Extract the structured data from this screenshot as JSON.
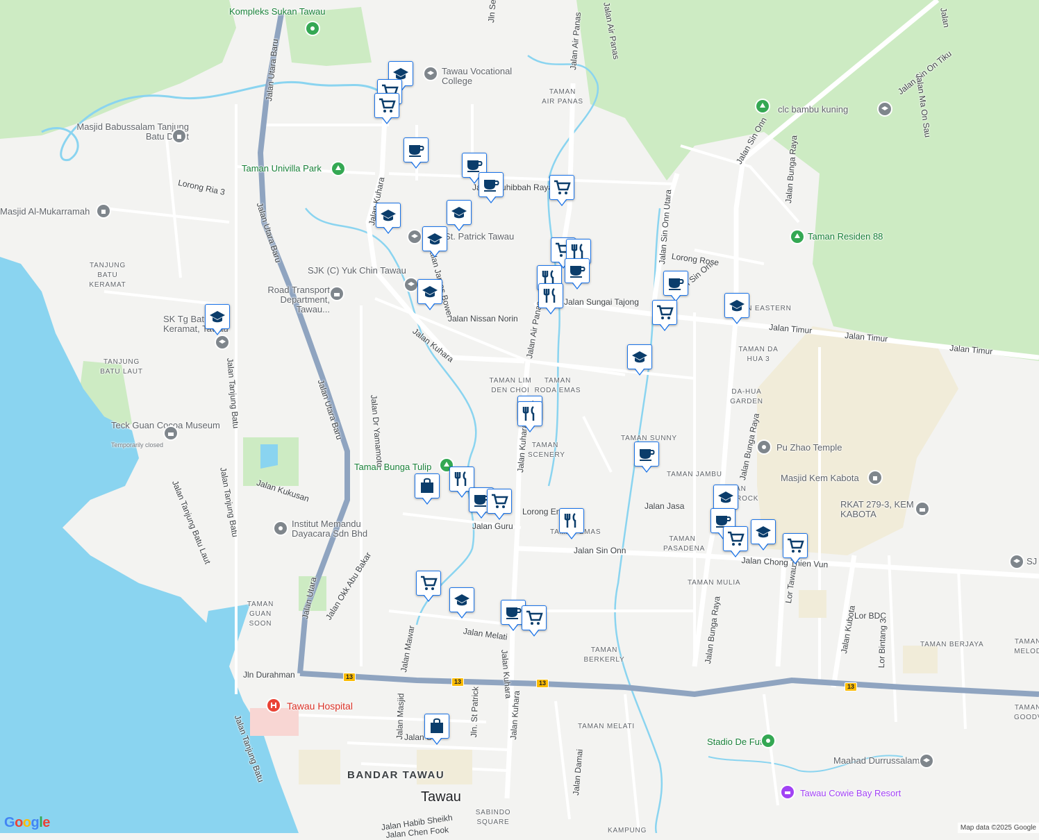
{
  "map": {
    "attribution": "Map data ©2025 Google",
    "logo": "Google",
    "colors": {
      "water": "#8ad4f0",
      "green": "#cdebc3",
      "road": "#ffffff",
      "highway": "#8fa4c0",
      "landuse": "#f3f3f1",
      "sand": "#f1ecd9"
    }
  },
  "labels": {
    "kompleks_sukan": "Kompleks Sukan Tawau",
    "tawau_vocational": "Tawau Vocational College",
    "masjid_babussalam": "Masjid Babussalam Tanjung Batu Darat",
    "taman_univilla": "Taman Univilla Park",
    "masjid_mukarramah": "Masjid Al-Mukarramah",
    "tanjung_batu_keramat": "TANJUNG BATU KERAMAT",
    "sjk_yuk_chin": "SJK (C) Yuk Chin Tawau",
    "road_transport": "Road Transport Department, Tawau...",
    "sk_tg_batu": "SK Tg Batu Keramat, Tawau",
    "tanjung_batu_laut": "TANJUNG BATU LAUT",
    "teck_guan": "Teck Guan Cocoa Museum",
    "teck_guan_status": "Temporarily closed",
    "taman_bunga_tulip": "Taman Bunga Tulip",
    "institut_memandu": "Institut Memandu Dayacara Sdn Bhd",
    "taman_guan_soon": "TAMAN GUAN SOON",
    "tawau_hospital": "Tawau Hospital",
    "bandar_tawau": "BANDAR TAWAU",
    "tawau": "Tawau",
    "sabindo_square": "SABINDO SQUARE",
    "taman_air_panas": "TAMAN AIR PANAS",
    "st_patrick": "St. Patrick Tawau",
    "clc_bambu": "clc bambu kuning",
    "taman_residen": "Taman Residen 88",
    "taman_eastern": "TAMAN EASTERN",
    "taman_da_hua": "TAMAN DA HUA 3",
    "da_hua_garden": "DA-HUA GARDEN",
    "taman_lim": "TAMAN LIM DEN CHOI",
    "taman_roda": "TAMAN RODA EMAS",
    "taman_scenery": "TAMAN SCENERY",
    "taman_sunny": "TAMAN SUNNY",
    "taman_jambu": "TAMAN JAMBU",
    "pu_zhao": "Pu Zhao Temple",
    "masjid_kem": "Masjid Kem Kabota",
    "rkat": "RKAT 279-3, KEM KABOTA",
    "taman_shamrock": "TAMAN SHAMROCK",
    "taman_pasadena": "TAMAN PASADENA",
    "taman_mulia": "TAMAN MULIA",
    "taman_emas": "TAMAN EMAS",
    "taman_berkerly": "TAMAN BERKERLY",
    "taman_melati": "TAMAN MELATI",
    "taman_berjaya": "TAMAN BERJAYA",
    "taman_melod": "TAMAN MELOD",
    "taman_goodv": "TAMAN GOODV",
    "stadio": "Stadio De Futsal",
    "maahad": "Maahad Durrussalam",
    "cowie_bay": "Tawau Cowie Bay Resort",
    "kampung": "KAMPUNG",
    "sj_edge": "SJ"
  },
  "roads": {
    "jalan_utara_baru_1": "Jalan Utara Baru",
    "jalan_utara_baru_2": "Jalan Utara Baru",
    "jalan_utara_baru_3": "Jalan Utara Baru",
    "jalan_utara": "Jalan Utara",
    "lorong_ria": "Lorong Ria 3",
    "jalan_kuhara_n": "Jalan Kuhara",
    "jalan_kuhara_m": "Jalan Kuhara",
    "jalan_kuhara_s": "Jalan Kuhara",
    "jalan_kuhara_c": "Jalan Kuhara",
    "jalan_kuhara_x": "Jalan Kuhara",
    "jalan_muhibbah": "Jalan Muhibbah Raya",
    "jalan_james": "Jalan James Bower",
    "jalan_nissan": "Jalan Nissan Norin",
    "jalan_air_panas_n": "Jalan Air Panas",
    "jalan_air_panas_ne": "Jalan Air Panas",
    "jalan_air_panas_m": "Jalan Air Panas",
    "jalan_sungai": "Jalan Sungai Tajong",
    "jalan_timur_1": "Jalan Timur",
    "jalan_timur_2": "Jalan Timur",
    "jalan_timur_3": "Jalan Timur",
    "jalan_sin_onn_n": "Jalan Sin Onn",
    "jalan_sin_onn_u": "Jalan Sin Onn Utara",
    "jalan_sin_onn_m": "Jalan Sin Onn",
    "jalan_sin_onn_s": "Jalan Sin Onn",
    "lorong_rose": "Lorong Rose",
    "jalan_bunga_raya_n": "Jalan Bunga Raya",
    "jalan_bunga_raya_m": "Jalan Bunga Raya",
    "jalan_bunga_raya_s": "Jalan Bunga Raya",
    "jalan_sin_on_tiku": "Jalan Sin On Tiku",
    "jalan_ma_on_sau": "Jalan Ma On Sau",
    "jalan_tanjung_batu_1": "Jalan Tanjung Batu",
    "jalan_tanjung_batu_2": "Jalan Tanjung Batu",
    "jalan_tanjung_batu_laut": "Jalan Tanjung Batu Laut",
    "jalan_tanjung_batu_s": "Jalan Tanjung Batu",
    "jalan_dr_yamamoto": "Jalan Dr Yamamoto",
    "jalan_kukusan": "Jalan Kukusan",
    "jalan_okk": "Jalan Okk Abu Bakar",
    "jalan_mawar": "Jalan Mawar",
    "jalan_masjid": "Jalan Masjid",
    "jalan_melati": "Jalan Melati",
    "jalan_guru": "Jalan Guru",
    "lorong_emas": "Lorong Emas",
    "jalan_jasa": "Jalan Jasa",
    "jalan_chong": "Jalan Chong Thien Vun",
    "lor_tawau": "Lor Tawau",
    "lor_bdc": "Lor BDC",
    "jalan_kubota": "Jalan Kubota",
    "lor_bintang": "Lor Bintang 3",
    "jalan_durahman": "Jln Durahman",
    "jln_st_patrick": "Jln. St Patrick",
    "jalan_damai": "Jalan Damai",
    "jalan_habib": "Jalan Habib Sheikh",
    "jalan_chen_fook": "Jalan Chen Fook",
    "jalan_s": "Jalan S",
    "jln_se": "Jln Se",
    "jalan_air_panas_top": "Jalan Air Panas",
    "jalan_top": "Jalan",
    "jalan_sin_onn_gap": "Jalan Sin Onn",
    "route_13": "13"
  },
  "markers": [
    {
      "type": "school-icon"
    },
    {
      "type": "shopping-cart-icon"
    },
    {
      "type": "shopping-cart-icon"
    },
    {
      "type": "cafe-icon"
    },
    {
      "type": "cafe-icon"
    },
    {
      "type": "cafe-icon"
    },
    {
      "type": "shopping-cart-icon"
    },
    {
      "type": "school-icon"
    },
    {
      "type": "school-icon"
    },
    {
      "type": "school-icon"
    },
    {
      "type": "school-icon"
    },
    {
      "type": "shopping-cart-icon"
    },
    {
      "type": "restaurant-icon"
    },
    {
      "type": "restaurant-icon"
    },
    {
      "type": "restaurant-icon"
    },
    {
      "type": "cafe-icon"
    },
    {
      "type": "cafe-icon"
    },
    {
      "type": "shopping-cart-icon"
    },
    {
      "type": "school-icon"
    },
    {
      "type": "school-icon"
    },
    {
      "type": "restaurant-icon"
    },
    {
      "type": "restaurant-icon"
    },
    {
      "type": "cafe-icon"
    },
    {
      "type": "school-icon"
    },
    {
      "type": "shopping-bag-icon"
    },
    {
      "type": "restaurant-icon"
    },
    {
      "type": "cafe-icon"
    },
    {
      "type": "shopping-cart-icon"
    },
    {
      "type": "restaurant-icon"
    },
    {
      "type": "school-icon"
    },
    {
      "type": "cafe-icon"
    },
    {
      "type": "shopping-cart-icon"
    },
    {
      "type": "school-icon"
    },
    {
      "type": "shopping-cart-icon"
    },
    {
      "type": "shopping-cart-icon"
    },
    {
      "type": "school-icon"
    },
    {
      "type": "cafe-icon"
    },
    {
      "type": "shopping-cart-icon"
    },
    {
      "type": "shopping-bag-icon"
    }
  ]
}
